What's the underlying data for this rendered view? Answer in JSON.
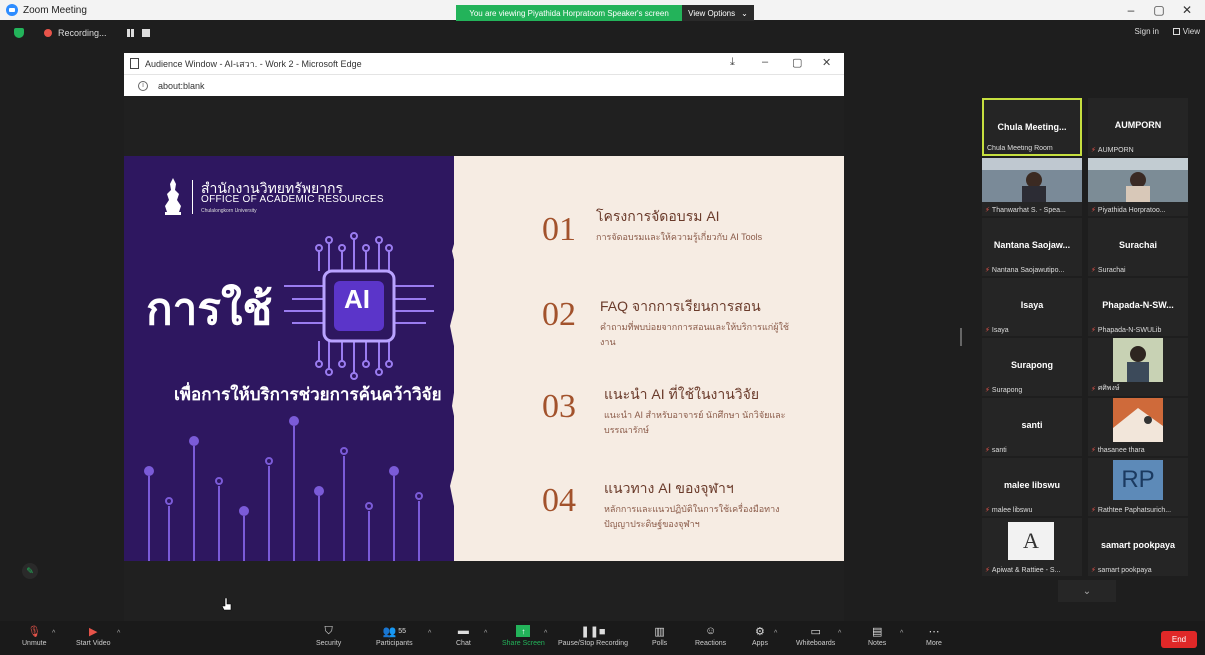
{
  "titlebar": {
    "app_title": "Zoom Meeting",
    "minimize": "–",
    "restore": "▢",
    "close": "✕"
  },
  "banner": {
    "viewing": "You are viewing Piyathida Horpratoom   Speaker's screen",
    "view_options": "View Options",
    "caret": "⌄"
  },
  "recording": {
    "label": "Recording...",
    "signin": "Sign in",
    "view": "View"
  },
  "edge": {
    "title": "Audience Window - AI-เสวา. - Work 2 - Microsoft Edge",
    "address": "about:blank",
    "controls": {
      "pin": "⤓",
      "minimize": "–",
      "restore": "▢",
      "close": "✕"
    }
  },
  "slide": {
    "org_th": "สำนักงานวิทยทรัพยากร",
    "org_en": "OFFICE OF ACADEMIC RESOURCES",
    "org_sub": "Chulalongkorn University",
    "headline": "การใช้",
    "chip_label": "AI",
    "subheadline": "เพื่อการให้บริการช่วยการค้นคว้าวิจัย",
    "items": [
      {
        "num": "01",
        "title": "โครงการจัดอบรม AI",
        "desc": "การจัดอบรมและให้ความรู้เกี่ยวกับ AI Tools"
      },
      {
        "num": "02",
        "title": "FAQ จากการเรียนการสอน",
        "desc": "คำถามที่พบบ่อยจากการสอนและให้บริการแก่ผู้ใช้งาน"
      },
      {
        "num": "03",
        "title": "แนะนำ AI ที่ใช้ในงานวิจัย",
        "desc": "แนะนำ AI สำหรับอาจารย์ นักศึกษา นักวิจัยและบรรณารักษ์"
      },
      {
        "num": "04",
        "title": "แนวทาง AI ของจุฬาฯ",
        "desc": "หลักการและแนวปฏิบัติในการใช้เครื่องมือทางปัญญาประดิษฐ์ของจุฬาฯ"
      }
    ]
  },
  "participants_grid": [
    {
      "name": "Chula Meeting...",
      "label": "Chula Meeting Room",
      "muted": false,
      "active": true
    },
    {
      "name": "AUMPORN",
      "label": "AUMPORN",
      "muted": true
    },
    {
      "name": "",
      "label": "Thanwarhat S. - Spea...",
      "muted": true,
      "video": true
    },
    {
      "name": "",
      "label": "Piyathida Horpratoo...",
      "muted": true,
      "video": true
    },
    {
      "name": "Nantana Saojaw...",
      "label": "Nantana Saojawutipo...",
      "muted": true
    },
    {
      "name": "Surachai",
      "label": "Surachai",
      "muted": true
    },
    {
      "name": "Isaya",
      "label": "Isaya",
      "muted": true
    },
    {
      "name": "Phapada-N-SW...",
      "label": "Phapada-N-SWULib",
      "muted": true
    },
    {
      "name": "Surapong",
      "label": "Surapong",
      "muted": true
    },
    {
      "name": "",
      "label": "ศศิพงษ์",
      "muted": true,
      "photo": true
    },
    {
      "name": "santi",
      "label": "santi",
      "muted": true
    },
    {
      "name": "",
      "label": "thasanee thara",
      "muted": true,
      "photo": true
    },
    {
      "name": "malee libswu",
      "label": "malee libswu",
      "muted": true
    },
    {
      "name": "RP",
      "label": "Rathtee Paphatsurich...",
      "muted": true
    },
    {
      "name": "A",
      "label": "Apiwat & Rattiee - S...",
      "muted": true
    },
    {
      "name": "samart pookpaya",
      "label": "samart pookpaya",
      "muted": true
    }
  ],
  "grid_nav": "⌄",
  "toolbar": {
    "unmute": "Unmute",
    "start_video": "Start Video",
    "security": "Security",
    "participants": "Participants",
    "participants_count": "55",
    "chat": "Chat",
    "share_screen": "Share Screen",
    "pause_recording": "Pause/Stop Recording",
    "polls": "Polls",
    "reactions": "Reactions",
    "apps": "Apps",
    "whiteboards": "Whiteboards",
    "notes": "Notes",
    "more": "More",
    "end": "End"
  },
  "colors": {
    "zoom_blue": "#2d8cff",
    "green": "#23b35a",
    "end_red": "#e02828",
    "slide_purple": "#2e1760",
    "slide_cream": "#f6ece3"
  }
}
